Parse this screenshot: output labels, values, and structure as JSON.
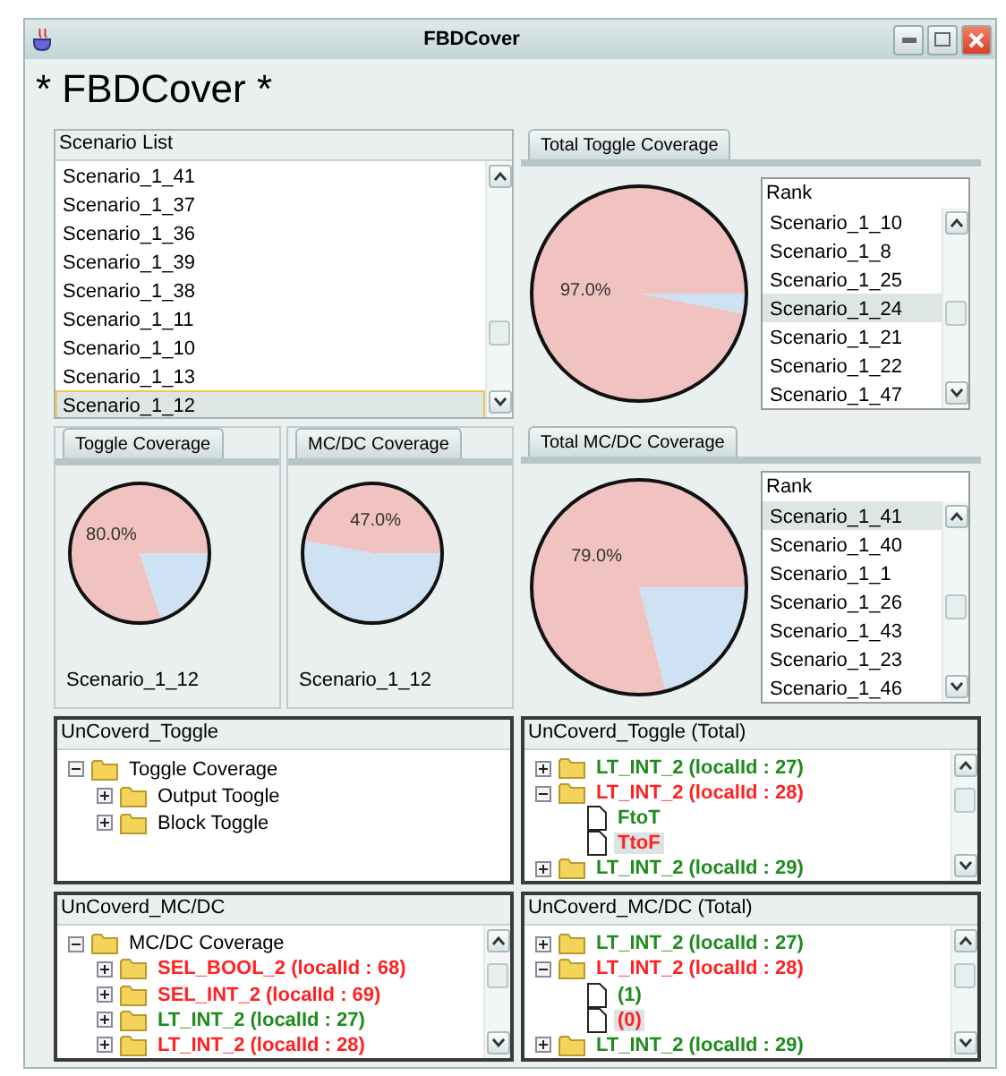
{
  "window": {
    "title": "FBDCover"
  },
  "heading": "* FBDCover *",
  "scenario_list": {
    "title": "Scenario List",
    "items": [
      {
        "label": "Scenario_1_41",
        "selected": false
      },
      {
        "label": "Scenario_1_37",
        "selected": false
      },
      {
        "label": "Scenario_1_36",
        "selected": false
      },
      {
        "label": "Scenario_1_39",
        "selected": false
      },
      {
        "label": "Scenario_1_38",
        "selected": false
      },
      {
        "label": "Scenario_1_11",
        "selected": false
      },
      {
        "label": "Scenario_1_10",
        "selected": false
      },
      {
        "label": "Scenario_1_13",
        "selected": false
      },
      {
        "label": "Scenario_1_12",
        "selected": true
      }
    ]
  },
  "total_toggle": {
    "tab": "Total Toggle Coverage",
    "label": "97.0%",
    "chart_data": {
      "type": "pie",
      "values": [
        97.0,
        3.0
      ]
    },
    "rank": {
      "title": "Rank",
      "items": [
        {
          "label": "Scenario_1_10",
          "selected": false
        },
        {
          "label": "Scenario_1_8",
          "selected": false
        },
        {
          "label": "Scenario_1_25",
          "selected": false
        },
        {
          "label": "Scenario_1_24",
          "selected": true
        },
        {
          "label": "Scenario_1_21",
          "selected": false
        },
        {
          "label": "Scenario_1_22",
          "selected": false
        },
        {
          "label": "Scenario_1_47",
          "selected": false
        }
      ]
    }
  },
  "toggle": {
    "tab": "Toggle Coverage",
    "label": "80.0%",
    "scenario": "Scenario_1_12",
    "chart_data": {
      "type": "pie",
      "values": [
        80.0,
        20.0
      ]
    }
  },
  "mcdc": {
    "tab": "MC/DC Coverage",
    "label": "47.0%",
    "scenario": "Scenario_1_12",
    "chart_data": {
      "type": "pie",
      "values": [
        47.0,
        53.0
      ]
    }
  },
  "total_mcdc": {
    "tab": "Total MC/DC Coverage",
    "label": "79.0%",
    "chart_data": {
      "type": "pie",
      "values": [
        79.0,
        21.0
      ]
    },
    "rank": {
      "title": "Rank",
      "items": [
        {
          "label": "Scenario_1_41",
          "selected": true
        },
        {
          "label": "Scenario_1_40",
          "selected": false
        },
        {
          "label": "Scenario_1_1",
          "selected": false
        },
        {
          "label": "Scenario_1_26",
          "selected": false
        },
        {
          "label": "Scenario_1_43",
          "selected": false
        },
        {
          "label": "Scenario_1_23",
          "selected": false
        },
        {
          "label": "Scenario_1_46",
          "selected": false
        }
      ]
    }
  },
  "trees": [
    {
      "title": "UnCoverd_Toggle",
      "scrollable": false,
      "nodes": [
        {
          "kind": "folder",
          "label": "Toggle Coverage",
          "color": "#000000",
          "bold": false,
          "selected": false,
          "expanded": true,
          "children": [
            {
              "kind": "folder",
              "label": "Output Toogle",
              "color": "#000000",
              "bold": false,
              "selected": false,
              "expanded": false
            },
            {
              "kind": "folder",
              "label": "Block Toggle",
              "color": "#000000",
              "bold": false,
              "selected": false,
              "expanded": false
            }
          ]
        }
      ]
    },
    {
      "title": "UnCoverd_Toggle (Total)",
      "scrollable": true,
      "nodes": [
        {
          "kind": "folder",
          "label": "LT_INT_2 (localId : 27)",
          "color": "#1e8c1e",
          "bold": true,
          "selected": false,
          "expanded": false
        },
        {
          "kind": "folder",
          "label": "LT_INT_2 (localId : 28)",
          "color": "#ff2222",
          "bold": true,
          "selected": false,
          "expanded": true,
          "children": [
            {
              "kind": "file",
              "label": "FtoT",
              "color": "#1e8c1e",
              "bold": true,
              "selected": false
            },
            {
              "kind": "file",
              "label": "TtoF",
              "color": "#ff2222",
              "bold": true,
              "selected": true
            }
          ]
        },
        {
          "kind": "folder",
          "label": "LT_INT_2 (localId : 29)",
          "color": "#1e8c1e",
          "bold": true,
          "selected": false,
          "expanded": false
        }
      ]
    },
    {
      "title": "UnCoverd_MC/DC",
      "scrollable": true,
      "nodes": [
        {
          "kind": "folder",
          "label": "MC/DC Coverage",
          "color": "#000000",
          "bold": false,
          "selected": false,
          "expanded": true,
          "children": [
            {
              "kind": "folder",
              "label": "SEL_BOOL_2 (localId : 68)",
              "color": "#ff2222",
              "bold": true,
              "selected": false,
              "expanded": false
            },
            {
              "kind": "folder",
              "label": "SEL_INT_2 (localId : 69)",
              "color": "#ff2222",
              "bold": true,
              "selected": false,
              "expanded": false
            },
            {
              "kind": "folder",
              "label": "LT_INT_2 (localId : 27)",
              "color": "#1e8c1e",
              "bold": true,
              "selected": false,
              "expanded": false
            },
            {
              "kind": "folder",
              "label": "LT_INT_2 (localId : 28)",
              "color": "#ff2222",
              "bold": true,
              "selected": false,
              "expanded": false
            }
          ]
        }
      ]
    },
    {
      "title": "UnCoverd_MC/DC (Total)",
      "scrollable": true,
      "nodes": [
        {
          "kind": "folder",
          "label": "LT_INT_2 (localId : 27)",
          "color": "#1e8c1e",
          "bold": true,
          "selected": false,
          "expanded": false
        },
        {
          "kind": "folder",
          "label": "LT_INT_2 (localId : 28)",
          "color": "#ff2222",
          "bold": true,
          "selected": false,
          "expanded": true,
          "children": [
            {
              "kind": "file",
              "label": "(1)",
              "color": "#1e8c1e",
              "bold": true,
              "selected": false
            },
            {
              "kind": "file",
              "label": "(0)",
              "color": "#ff2222",
              "bold": true,
              "selected": true
            }
          ]
        },
        {
          "kind": "folder",
          "label": "LT_INT_2 (localId : 29)",
          "color": "#1e8c1e",
          "bold": true,
          "selected": false,
          "expanded": false
        }
      ]
    }
  ]
}
